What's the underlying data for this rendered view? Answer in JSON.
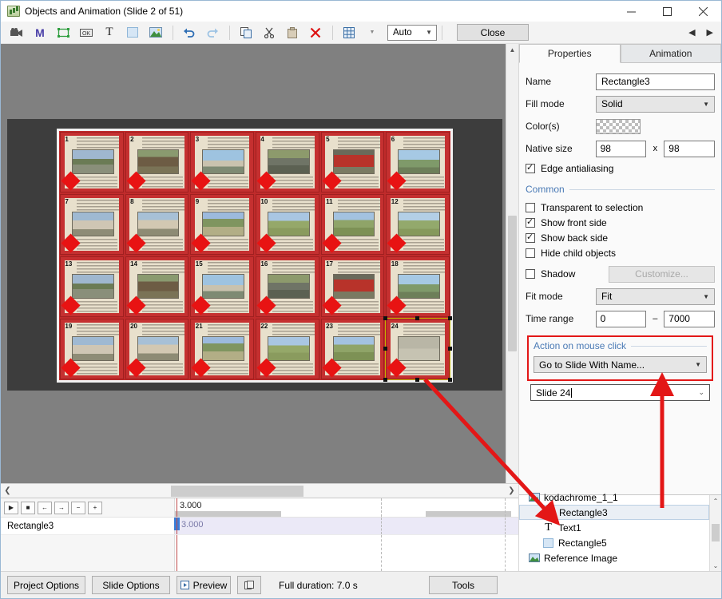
{
  "window": {
    "title": "Objects and Animation (Slide 2 of 51)",
    "minimize": "—",
    "maximize": "□",
    "close": "✕"
  },
  "toolbar": {
    "items": [
      {
        "name": "video-icon",
        "glyph": "video"
      },
      {
        "name": "mask-icon",
        "glyph": "M"
      },
      {
        "name": "rectangle-icon",
        "glyph": "rect"
      },
      {
        "name": "button-icon",
        "glyph": "btn"
      },
      {
        "name": "text-icon",
        "glyph": "T"
      },
      {
        "name": "shape-icon",
        "glyph": "shape"
      },
      {
        "name": "image-icon",
        "glyph": "img"
      },
      {
        "name": "undo-icon",
        "glyph": "undo"
      },
      {
        "name": "redo-icon",
        "glyph": "redo"
      },
      {
        "name": "copy-icon",
        "glyph": "copy"
      },
      {
        "name": "cut-icon",
        "glyph": "cut"
      },
      {
        "name": "paste-icon",
        "glyph": "paste"
      },
      {
        "name": "delete-icon",
        "glyph": "x"
      },
      {
        "name": "grid-icon",
        "glyph": "grid"
      }
    ],
    "zoom_value": "Auto",
    "close_label": "Close",
    "prev_arrow": "◀",
    "next_arrow": "▶"
  },
  "panel": {
    "tabs": [
      {
        "label": "Properties",
        "active": true
      },
      {
        "label": "Animation",
        "active": false
      }
    ],
    "name_label": "Name",
    "name_value": "Rectangle3",
    "fill_mode_label": "Fill mode",
    "fill_mode_value": "Solid",
    "colors_label": "Color(s)",
    "native_size_label": "Native size",
    "native_width": "98",
    "native_height": "98",
    "size_separator": "x",
    "edge_antialiasing": "Edge antialiasing",
    "common_label": "Common",
    "checks": [
      {
        "label": "Transparent to selection",
        "checked": false
      },
      {
        "label": "Show front side",
        "checked": true
      },
      {
        "label": "Show back side",
        "checked": true
      },
      {
        "label": "Hide child objects",
        "checked": false
      }
    ],
    "shadow_label": "Shadow",
    "shadow_checked": false,
    "customize_label": "Customize...",
    "fit_mode_label": "Fit mode",
    "fit_mode_value": "Fit",
    "time_range_label": "Time range",
    "time_start": "0",
    "time_dash": "–",
    "time_end": "7000",
    "action_label": "Action on mouse click",
    "action_value": "Go to Slide With Name...",
    "slide_target_value": "Slide 24",
    "highlight_color": "#e31717"
  },
  "tree": {
    "items": [
      {
        "label": "kodachrome_1_1",
        "icon": "image-icon",
        "indent": 0,
        "selected": false
      },
      {
        "label": "Rectangle3",
        "icon": "rectangle-icon",
        "indent": 1,
        "selected": true
      },
      {
        "label": "Text1",
        "icon": "text-icon",
        "indent": 1,
        "selected": false
      },
      {
        "label": "Rectangle5",
        "icon": "shape-icon",
        "indent": 1,
        "selected": false
      },
      {
        "label": "Reference Image",
        "icon": "image-icon",
        "indent": 0,
        "selected": false
      }
    ]
  },
  "timeline": {
    "buttons": [
      "▶",
      "■",
      "←",
      "→",
      "−",
      "+"
    ],
    "ruler_time": "3.000",
    "track_name": "Rectangle3",
    "track_time": "3.000"
  },
  "statusbar": {
    "project_options": "Project Options",
    "slide_options": "Slide Options",
    "preview": "Preview",
    "duration": "Full duration: 7.0 s",
    "tools": "Tools"
  },
  "canvas": {
    "slide_count": 24,
    "slides": [
      {
        "n": "1",
        "img": "cottage",
        "selected": false
      },
      {
        "n": "2",
        "img": "barn",
        "selected": false
      },
      {
        "n": "3",
        "img": "lake",
        "selected": false
      },
      {
        "n": "4",
        "img": "road",
        "selected": false
      },
      {
        "n": "5",
        "img": "redbarn",
        "selected": false
      },
      {
        "n": "6",
        "img": "hills",
        "selected": false
      },
      {
        "n": "7",
        "img": "houses",
        "selected": false
      },
      {
        "n": "8",
        "img": "houses2",
        "selected": false
      },
      {
        "n": "9",
        "img": "path",
        "selected": false
      },
      {
        "n": "10",
        "img": "field",
        "selected": false
      },
      {
        "n": "11",
        "img": "meadow",
        "selected": false
      },
      {
        "n": "12",
        "img": "green",
        "selected": false
      },
      {
        "n": "13",
        "img": "cottage",
        "selected": false
      },
      {
        "n": "14",
        "img": "barn",
        "selected": false
      },
      {
        "n": "15",
        "img": "lake",
        "selected": false
      },
      {
        "n": "16",
        "img": "road",
        "selected": false
      },
      {
        "n": "17",
        "img": "redbarn",
        "selected": false
      },
      {
        "n": "18",
        "img": "hills",
        "selected": false
      },
      {
        "n": "19",
        "img": "houses",
        "selected": false
      },
      {
        "n": "20",
        "img": "houses2",
        "selected": false
      },
      {
        "n": "21",
        "img": "path",
        "selected": false
      },
      {
        "n": "22",
        "img": "field",
        "selected": false
      },
      {
        "n": "23",
        "img": "meadow",
        "selected": false
      },
      {
        "n": "24",
        "img": "blank",
        "selected": true
      }
    ]
  }
}
